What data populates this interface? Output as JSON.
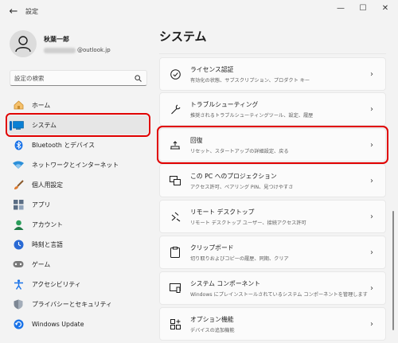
{
  "titlebar": {
    "back_icon": "back-arrow-icon",
    "title": "設定",
    "minimize": "—",
    "maximize": "☐",
    "close": "✕"
  },
  "user": {
    "name": "秋葉一郎",
    "email": "@outlook.jp"
  },
  "search": {
    "placeholder": "設定の検索",
    "icon": "search-icon"
  },
  "nav": {
    "items": [
      {
        "label": "ホーム",
        "icon": "home-icon",
        "color": "#e8a44a"
      },
      {
        "label": "システム",
        "icon": "system-monitor-icon",
        "color": "#0a7fd4",
        "selected": true
      },
      {
        "label": "Bluetooth とデバイス",
        "icon": "bluetooth-icon",
        "color": "#1a73e8"
      },
      {
        "label": "ネットワークとインターネット",
        "icon": "wifi-icon",
        "color": "#2b8fd9"
      },
      {
        "label": "個人用設定",
        "icon": "brush-icon",
        "color": "#e07b2e"
      },
      {
        "label": "アプリ",
        "icon": "apps-icon",
        "color": "#5a6d84"
      },
      {
        "label": "アカウント",
        "icon": "account-icon",
        "color": "#2a9d5a"
      },
      {
        "label": "時刻と言語",
        "icon": "clock-globe-icon",
        "color": "#2a6ad4"
      },
      {
        "label": "ゲーム",
        "icon": "gamepad-icon",
        "color": "#7a7a7a"
      },
      {
        "label": "アクセシビリティ",
        "icon": "accessibility-icon",
        "color": "#1a73e8"
      },
      {
        "label": "プライバシーとセキュリティ",
        "icon": "shield-icon",
        "color": "#7d8794"
      },
      {
        "label": "Windows Update",
        "icon": "windows-update-icon",
        "color": "#1a73e8"
      }
    ]
  },
  "main": {
    "title": "システム",
    "cards": [
      {
        "title": "ライセンス認証",
        "desc": "有効化の状態、サブスクリプション、プロダクト キー",
        "icon": "check-circle-icon"
      },
      {
        "title": "トラブルシューティング",
        "desc": "推奨されるトラブルシューティングツール、設定、履歴",
        "icon": "wrench-icon"
      },
      {
        "title": "回復",
        "desc": "リセット、スタートアップの詳細設定、戻る",
        "icon": "recovery-icon",
        "highlight": true
      },
      {
        "title": "この PC へのプロジェクション",
        "desc": "アクセス許可、ペアリング PIN、見つけやすさ",
        "icon": "projection-icon"
      },
      {
        "title": "リモート デスクトップ",
        "desc": "リモート デスクトップ ユーザー、接続アクセス許可",
        "icon": "remote-desktop-icon"
      },
      {
        "title": "クリップボード",
        "desc": "切り取りおよびコピーの履歴、同期、クリア",
        "icon": "clipboard-icon"
      },
      {
        "title": "システム コンポーネント",
        "desc": "Windows にプレインストールされているシステム コンポーネントを管理します",
        "icon": "system-component-icon"
      },
      {
        "title": "オプション機能",
        "desc": "デバイスの追加機能",
        "icon": "optional-features-icon"
      }
    ],
    "chevron": "›"
  }
}
